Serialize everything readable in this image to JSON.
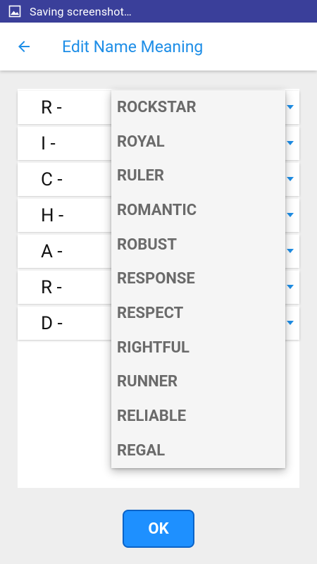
{
  "status_bar": {
    "text": "Saving screenshot…",
    "icon": "image-icon"
  },
  "app_bar": {
    "title": "Edit Name Meaning",
    "back_icon": "arrow-left-icon"
  },
  "rows": [
    {
      "label": "R -"
    },
    {
      "label": "I -"
    },
    {
      "label": "C -"
    },
    {
      "label": "H -"
    },
    {
      "label": "A -"
    },
    {
      "label": "R -"
    },
    {
      "label": "D -"
    }
  ],
  "dropdown_options": [
    "ROCKSTAR",
    "ROYAL",
    "RULER",
    "ROMANTIC",
    "ROBUST",
    "RESPONSE",
    "RESPECT",
    "RIGHTFUL",
    "RUNNER",
    "RELIABLE",
    "REGAL"
  ],
  "ok_button": {
    "label": "OK"
  },
  "colors": {
    "accent": "#1e8ee7",
    "status_bar": "#3a3f9a",
    "ok_button": "#1e90ff",
    "option_text": "#6a6a6a",
    "background": "#eeeeee"
  }
}
